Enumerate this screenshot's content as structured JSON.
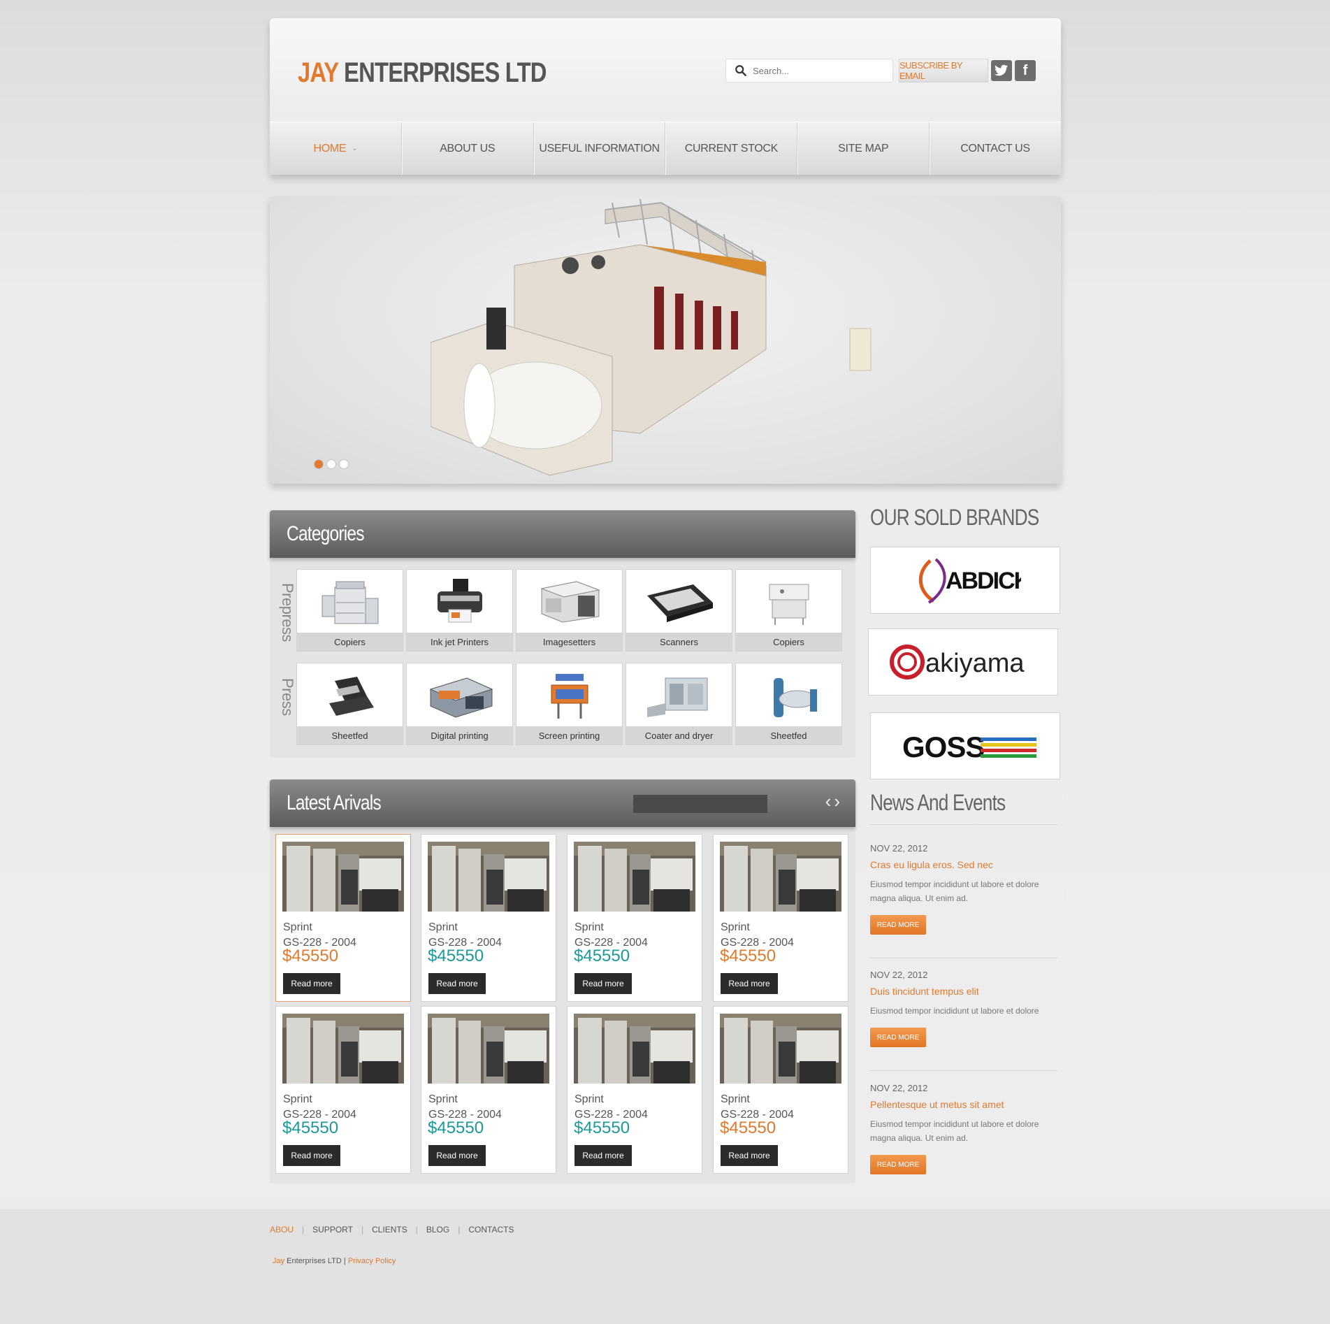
{
  "logo": {
    "part1": "JAY",
    "part2": "ENTERPRISES LTD"
  },
  "search": {
    "placeholder": "Search..."
  },
  "subscribe_label": "SUBSCRIBE BY EMAIL",
  "social": {
    "twitter": "twitter-icon",
    "facebook": "facebook-icon",
    "facebook_glyph": "f"
  },
  "nav": [
    "HOME",
    "ABOUT US",
    "USEFUL INFORMATION",
    "CURRENT STOCK",
    "SITE MAP",
    "CONTACT US"
  ],
  "slider": {
    "slides": 3,
    "active": 0
  },
  "categories": {
    "title": "Categories",
    "prepress_label": "Prepress",
    "press_label": "Press",
    "prepress": [
      "Copiers",
      "Ink jet Printers",
      "Imagesetters",
      "Scanners",
      "Copiers"
    ],
    "press": [
      "Sheetfed",
      "Digital printing",
      "Screen printing",
      "Coater and dryer",
      "Sheetfed"
    ]
  },
  "latest": {
    "title": "Latest Arivals",
    "products": [
      {
        "name": "Sprint",
        "model": "GS-228 - 2004",
        "price": "$45550",
        "color": "orange",
        "btn": "Read more"
      },
      {
        "name": "Sprint",
        "model": "GS-228 - 2004",
        "price": "$45550",
        "color": "teal",
        "btn": "Read more"
      },
      {
        "name": "Sprint",
        "model": "GS-228 - 2004",
        "price": "$45550",
        "color": "teal",
        "btn": "Read more"
      },
      {
        "name": "Sprint",
        "model": "GS-228 - 2004",
        "price": "$45550",
        "color": "orange",
        "btn": "Read more"
      },
      {
        "name": "Sprint",
        "model": "GS-228 - 2004",
        "price": "$45550",
        "color": "teal",
        "btn": "Read more"
      },
      {
        "name": "Sprint",
        "model": "GS-228 - 2004",
        "price": "$45550",
        "color": "teal",
        "btn": "Read more"
      },
      {
        "name": "Sprint",
        "model": "GS-228 - 2004",
        "price": "$45550",
        "color": "teal",
        "btn": "Read more"
      },
      {
        "name": "Sprint",
        "model": "GS-228 - 2004",
        "price": "$45550",
        "color": "orange",
        "btn": "Read more"
      }
    ]
  },
  "brands": {
    "title": "OUR SOLD BRANDS",
    "items": [
      "ABDICK",
      "akiyama",
      "GOSS"
    ]
  },
  "news": {
    "title": "News And Events",
    "items": [
      {
        "date": "NOV 22, 2012",
        "title": "Cras eu ligula eros. Sed nec",
        "text": "Eiusmod tempor incididunt ut labore et dolore magna aliqua. Ut enim ad.",
        "more": "READ MORE"
      },
      {
        "date": "NOV 22, 2012",
        "title": "Duis tincidunt tempus elit",
        "text": "Eiusmod tempor incididunt ut labore et dolore",
        "more": "READ MORE"
      },
      {
        "date": "NOV 22, 2012",
        "title": "Pellentesque ut metus sit amet",
        "text": "Eiusmod tempor incididunt ut labore et dolore magna aliqua. Ut enim ad.",
        "more": "READ MORE"
      }
    ]
  },
  "footer": {
    "links": [
      "ABOU",
      "SUPPORT",
      "CLIENTS",
      "BLOG",
      "CONTACTS"
    ],
    "copy_jay": "Jay",
    "copy_rest": " Enterprises LTD",
    "privacy": "Privacy Policy"
  },
  "colors": {
    "accent": "#e07a2e",
    "teal": "#1a9a9a",
    "dark": "#2b2b2b"
  }
}
